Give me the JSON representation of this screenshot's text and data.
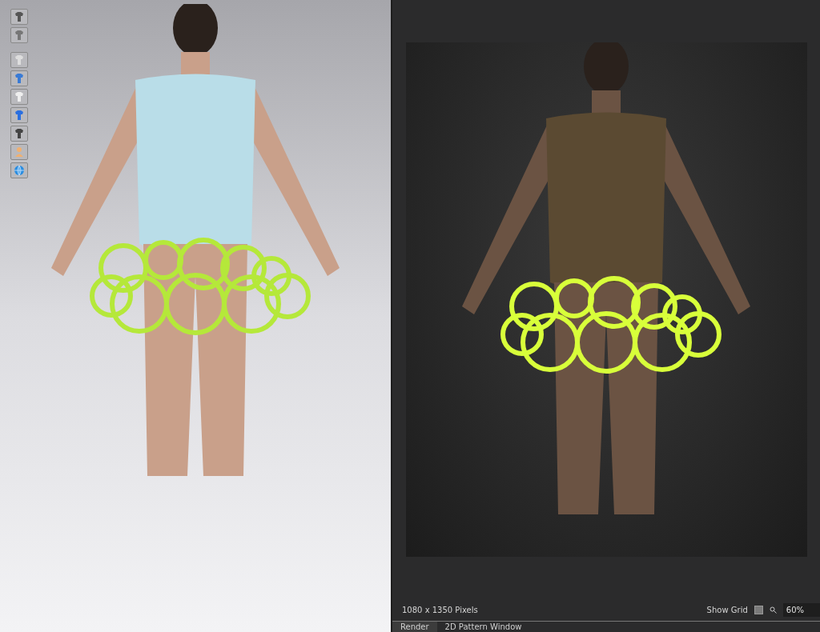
{
  "render_view": {
    "size_text": "1080 x 1350 Pixels",
    "show_grid": {
      "label": "Show Grid",
      "checked": false
    },
    "zoom": "60%"
  },
  "tabs": [
    {
      "label": "Render",
      "selected": true
    },
    {
      "label": "2D Pattern Window",
      "selected": false
    }
  ]
}
